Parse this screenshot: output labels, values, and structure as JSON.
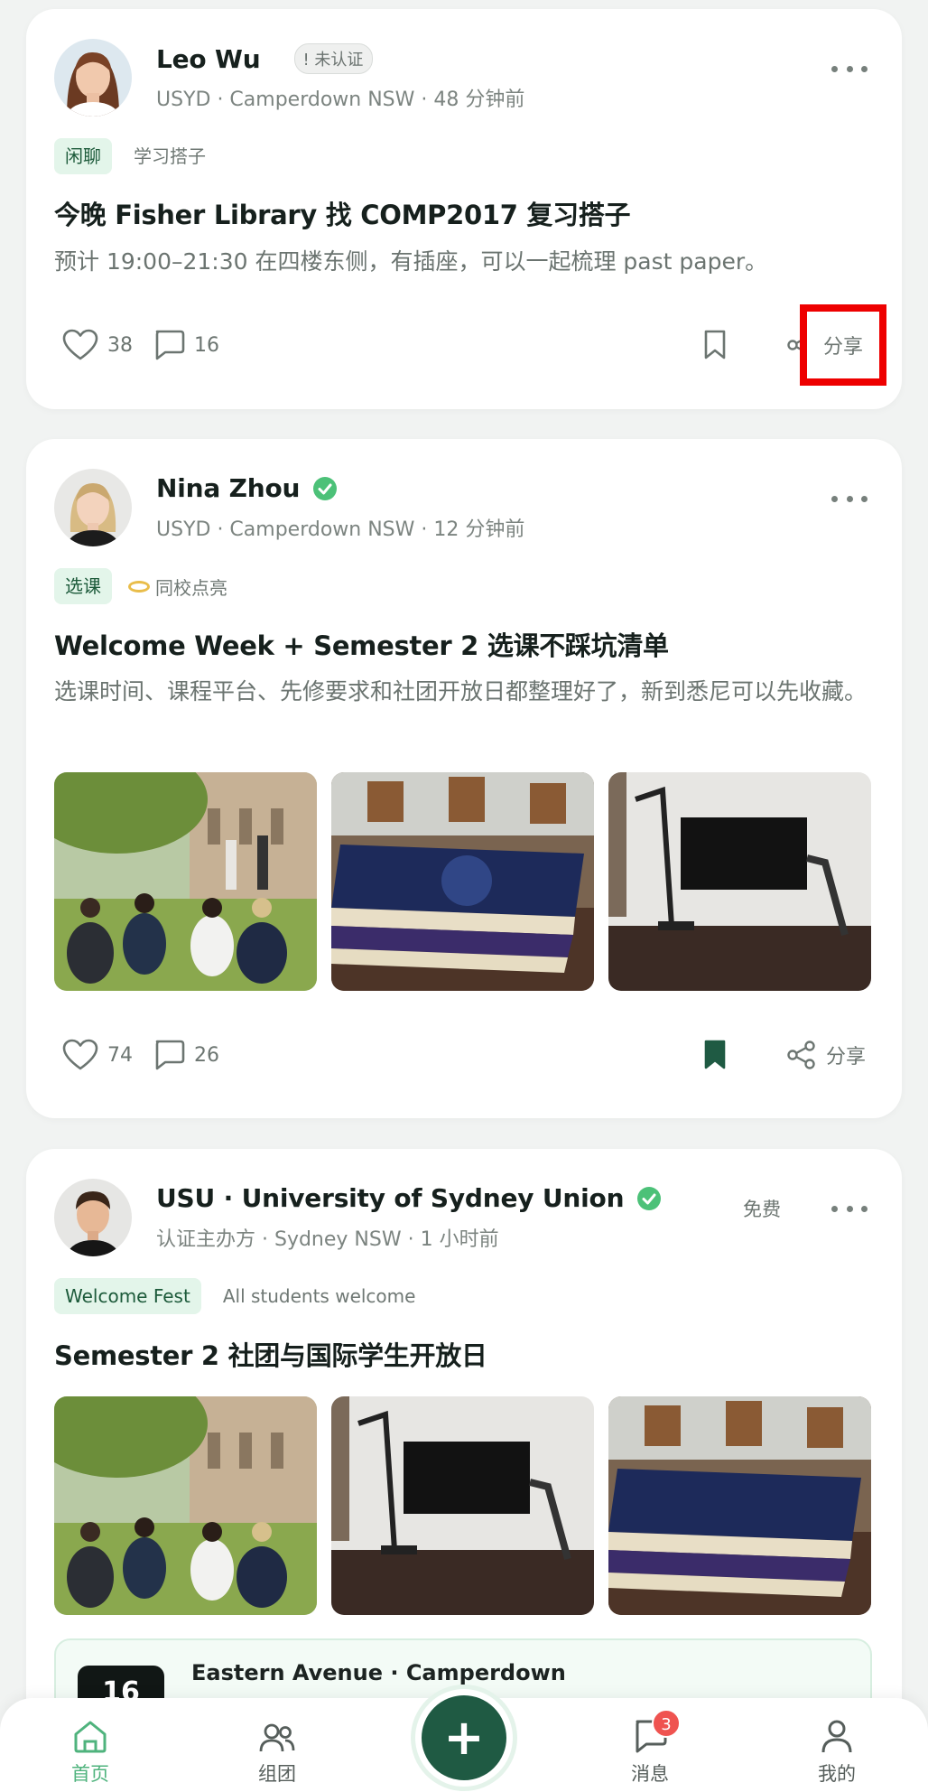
{
  "posts": [
    {
      "author": "Leo Wu",
      "badge": "! 未认证",
      "meta": "USYD · Camperdown NSW · 48 分钟前",
      "tag_primary": "闲聊",
      "tag_secondary": "学习搭子",
      "title": "今晚 Fisher Library 找 COMP2017 复习搭子",
      "desc": "预计 19:00–21:30 在四楼东侧，有插座，可以一起梳理 past paper。",
      "likes": "38",
      "comments": "16",
      "share_label": "分享",
      "bookmarked": false
    },
    {
      "author": "Nina Zhou",
      "meta": "USYD · Camperdown NSW · 12 分钟前",
      "tag_primary": "选课",
      "tag_secondary": "同校点亮",
      "title": "Welcome Week + Semester 2 选课不踩坑清单",
      "desc": "选课时间、课程平台、先修要求和社团开放日都整理好了，新到悉尼可以先收藏。",
      "likes": "74",
      "comments": "26",
      "share_label": "分享",
      "bookmarked": true
    },
    {
      "author": "USU · University of Sydney Union",
      "meta": "认证主办方 · Sydney NSW · 1 小时前",
      "price": "免费",
      "tag_primary": "Welcome Fest",
      "tag_secondary": "All students welcome",
      "title": "Semester 2 社团与国际学生开放日",
      "event_day": "16",
      "event_place": "Eastern Avenue · Camperdown"
    }
  ],
  "tabbar": {
    "home": "首页",
    "groups": "组团",
    "messages": "消息",
    "messages_unread": "3",
    "me": "我的",
    "fab": "+"
  },
  "colors": {
    "accent": "#1f5a43",
    "accent_light": "#4fb37d",
    "tag_bg": "#e3f5ea",
    "highlight": "#ee0000",
    "badge_red": "#ef5350"
  }
}
